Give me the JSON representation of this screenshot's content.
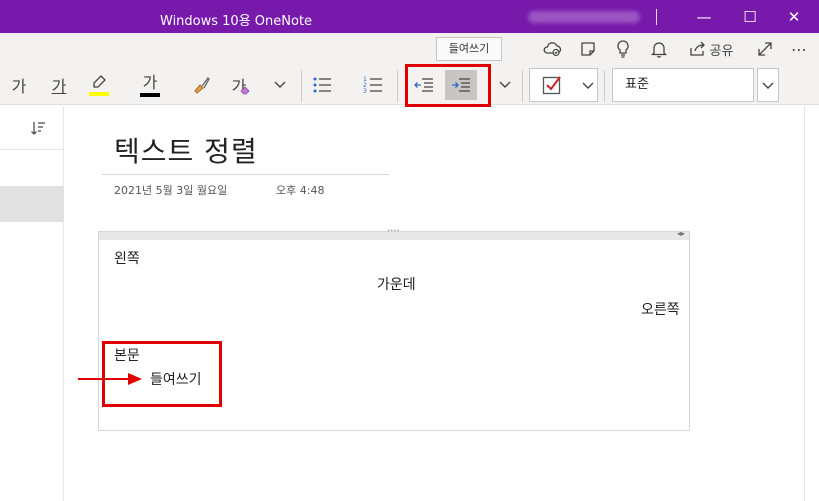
{
  "window": {
    "title": "Windows 10용 OneNote",
    "minimize": "—",
    "maximize": "☐",
    "close": "✕"
  },
  "ribbon": {
    "font_a": "가",
    "underline_a": "가",
    "font_color_a": "가",
    "clear_a": "가",
    "tooltip": "들여쓰기",
    "share_label": "공유",
    "style_value": "표준"
  },
  "page": {
    "title": "텍스트 정렬",
    "date": "2021년 5월 3일 월요일",
    "time": "오후 4:48",
    "lines": {
      "left": "왼쪽",
      "center": "가운데",
      "right": "오른쪽",
      "body": "본문",
      "indent": "들여쓰기"
    }
  },
  "colors": {
    "titlebar": "#7719aa",
    "highlight_yellow": "#ffff00",
    "annotation_red": "#e00000",
    "checkbox_red": "#c4262e"
  }
}
